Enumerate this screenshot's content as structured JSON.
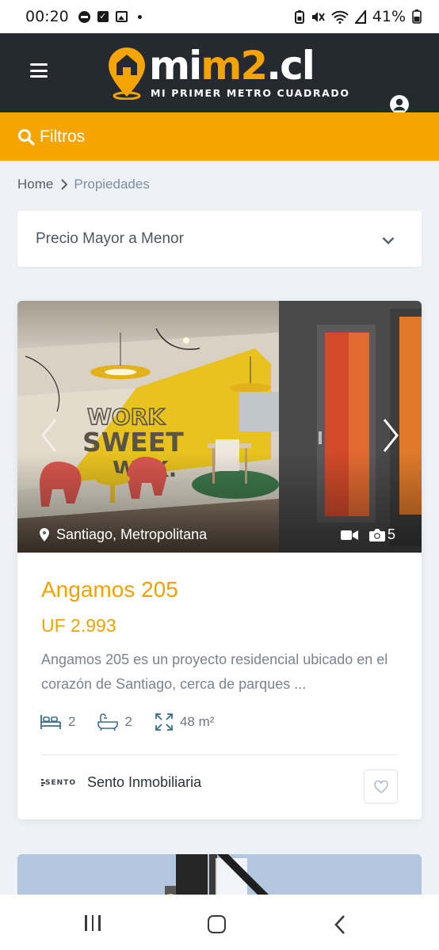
{
  "status_bar": {
    "time": "00:20",
    "battery": "41%",
    "icons": [
      "dnd-icon",
      "check-icon",
      "image-icon",
      "dot-icon",
      "battery-saver-icon",
      "mute-icon",
      "wifi-icon",
      "signal-icon",
      "battery-icon"
    ]
  },
  "header": {
    "logo_main_white": "mi",
    "logo_main_orange": "m2",
    "logo_suffix": ".cl",
    "logo_tagline": "MI PRIMER METRO CUADRADO",
    "menu_icon": "hamburger-icon",
    "user_icon": "user-circle-icon"
  },
  "filters": {
    "label": "Filtros",
    "icon": "search-icon"
  },
  "breadcrumb": {
    "home": "Home",
    "current": "Propiedades"
  },
  "sort": {
    "selected": "Precio Mayor a Menor"
  },
  "listing": {
    "location": "Santiago, Metropolitana",
    "photo_count": "5",
    "title": "Angamos 205",
    "price": "UF 2.993",
    "description": "Angamos 205 es un proyecto residencial ubicado en el corazón de Santiago, cerca de parques ...",
    "bedrooms": "2",
    "bathrooms": "2",
    "area": "48 m²",
    "agency_logo_text": "SENTO",
    "agency_name": "Sento Inmobiliaria"
  },
  "colors": {
    "brand_orange": "#f6a500",
    "header_dark": "#252a31",
    "page_bg": "#eef1f5"
  }
}
